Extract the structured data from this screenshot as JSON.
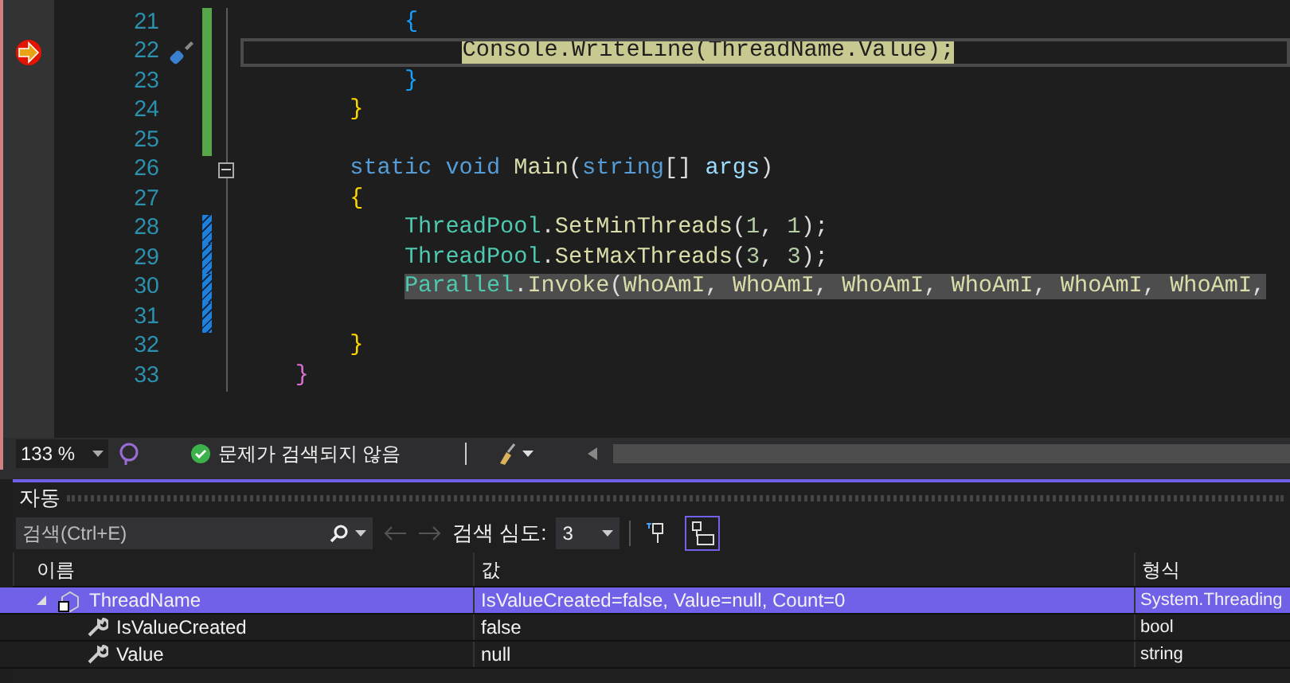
{
  "editor": {
    "lines": [
      {
        "number": "21",
        "kind": "saved",
        "fold": false,
        "current": false,
        "selected": false,
        "segments": [
          {
            "text": "            {",
            "kind": "brace"
          }
        ]
      },
      {
        "number": "22",
        "kind": "saved",
        "fold": false,
        "current": true,
        "selected": false,
        "segments": [
          {
            "text": "                Console.WriteLine(ThreadName.Value);",
            "kind": "marked"
          }
        ]
      },
      {
        "number": "23",
        "kind": "saved",
        "fold": false,
        "current": false,
        "selected": false,
        "segments": [
          {
            "text": "            }",
            "kind": "brace"
          }
        ]
      },
      {
        "number": "24",
        "kind": "saved",
        "fold": false,
        "current": false,
        "selected": false,
        "segments": [
          {
            "text": "        }",
            "kind": "brace2"
          }
        ]
      },
      {
        "number": "25",
        "kind": "saved",
        "fold": false,
        "current": false,
        "selected": false
      },
      {
        "number": "26",
        "kind": "plain",
        "fold": true,
        "current": false,
        "selected": false,
        "segments": [
          {
            "text": "        static ",
            "kind": "keyword"
          },
          {
            "text": "void ",
            "kind": "keyword"
          },
          {
            "text": "Main",
            "kind": "method"
          },
          {
            "text": "(",
            "kind": "plain"
          },
          {
            "text": "string",
            "kind": "keyword"
          },
          {
            "text": "[] ",
            "kind": "plain"
          },
          {
            "text": "args",
            "kind": "param"
          },
          {
            "text": ")",
            "kind": "plain"
          }
        ]
      },
      {
        "number": "27",
        "kind": "plain",
        "fold": false,
        "current": false,
        "selected": false,
        "segments": [
          {
            "text": "        {",
            "kind": "brace2"
          }
        ]
      },
      {
        "number": "28",
        "kind": "unsaved",
        "fold": false,
        "current": false,
        "selected": false,
        "segments": [
          {
            "text": "            ThreadPool",
            "kind": "type"
          },
          {
            "text": ".",
            "kind": "plain"
          },
          {
            "text": "SetMinThreads",
            "kind": "method"
          },
          {
            "text": "(",
            "kind": "plain"
          },
          {
            "text": "1",
            "kind": "number"
          },
          {
            "text": ", ",
            "kind": "plain"
          },
          {
            "text": "1",
            "kind": "number"
          },
          {
            "text": ");",
            "kind": "plain"
          }
        ]
      },
      {
        "number": "29",
        "kind": "unsaved",
        "fold": false,
        "current": false,
        "selected": false,
        "segments": [
          {
            "text": "            ThreadPool",
            "kind": "type"
          },
          {
            "text": ".",
            "kind": "plain"
          },
          {
            "text": "SetMaxThreads",
            "kind": "method"
          },
          {
            "text": "(",
            "kind": "plain"
          },
          {
            "text": "3",
            "kind": "number"
          },
          {
            "text": ", ",
            "kind": "plain"
          },
          {
            "text": "3",
            "kind": "number"
          },
          {
            "text": ");",
            "kind": "plain"
          }
        ]
      },
      {
        "number": "30",
        "kind": "unsaved",
        "fold": false,
        "current": false,
        "selected": true,
        "segments": [
          {
            "text": "            Parallel",
            "kind": "type"
          },
          {
            "text": ".",
            "kind": "plain"
          },
          {
            "text": "Invoke",
            "kind": "method"
          },
          {
            "text": "(",
            "kind": "plain"
          },
          {
            "text": "WhoAmI",
            "kind": "method"
          },
          {
            "text": ", ",
            "kind": "plain"
          },
          {
            "text": "WhoAmI",
            "kind": "method"
          },
          {
            "text": ", ",
            "kind": "plain"
          },
          {
            "text": "WhoAmI",
            "kind": "method"
          },
          {
            "text": ", ",
            "kind": "plain"
          },
          {
            "text": "WhoAmI",
            "kind": "method"
          },
          {
            "text": ", ",
            "kind": "plain"
          },
          {
            "text": "WhoAmI",
            "kind": "method"
          },
          {
            "text": ", ",
            "kind": "plain"
          },
          {
            "text": "WhoAmI",
            "kind": "method"
          },
          {
            "text": ",",
            "kind": "plain"
          }
        ]
      },
      {
        "number": "31",
        "kind": "unsaved",
        "fold": false,
        "current": false,
        "selected": false
      },
      {
        "number": "32",
        "kind": "plain",
        "fold": false,
        "current": false,
        "selected": false,
        "segments": [
          {
            "text": "        }",
            "kind": "brace2"
          }
        ]
      },
      {
        "number": "33",
        "kind": "plain",
        "fold": false,
        "current": false,
        "selected": false,
        "segments": [
          {
            "text": "    }",
            "kind": "brace3"
          }
        ]
      }
    ]
  },
  "status_bar": {
    "zoom": "133 %",
    "issues": "문제가 검색되지 않음"
  },
  "autos_panel": {
    "title": "자동",
    "search": {
      "placeholder": "검색(Ctrl+E)"
    },
    "depth_label": "검색 심도:",
    "depth": "3",
    "toolbar_toggles": [
      {
        "selected": false
      },
      {
        "selected": true
      }
    ],
    "columns": [
      "이름",
      "값",
      "형식"
    ],
    "rows": [
      {
        "name": "ThreadName",
        "value": "IsValueCreated=false, Value=null, Count=0",
        "type": "System.Threading",
        "selected": true,
        "expanded": true,
        "children": [
          {
            "name": "IsValueCreated",
            "value": "false",
            "type": "bool",
            "selected": false
          },
          {
            "name": "Value",
            "value": "null",
            "type": "string",
            "selected": false
          }
        ]
      }
    ]
  }
}
